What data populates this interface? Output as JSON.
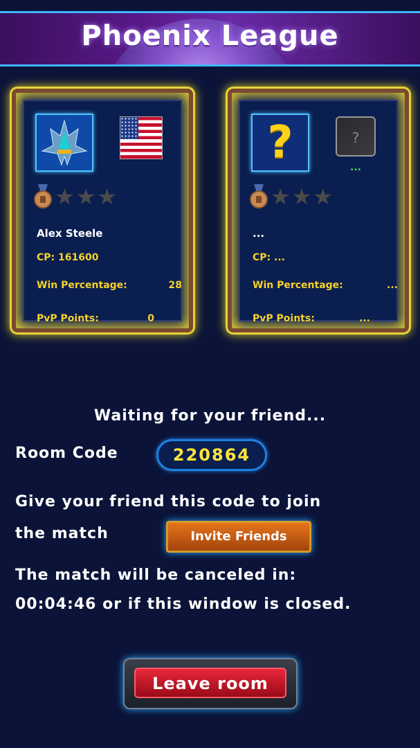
{
  "header": {
    "title": "Phoenix League"
  },
  "player1": {
    "name": "Alex Steele",
    "cp_label": "CP:",
    "cp_value": "161600",
    "win_label": "Win Percentage:",
    "win_value": "28",
    "pvp_label": "PvP Points:",
    "pvp_value": "0",
    "flag_icon": "usa-flag-icon",
    "stars_filled": 0,
    "stars_total": 3
  },
  "player2": {
    "name": "...",
    "cp_label": "CP:",
    "cp_value": "...",
    "win_label": "Win Percentage:",
    "win_value": "...",
    "pvp_label": "PvP Points:",
    "pvp_value": "...",
    "avatar_mark": "?",
    "flag_mark": "?",
    "flag_caption": "...",
    "stars_filled": 0,
    "stars_total": 3
  },
  "status": {
    "waiting": "Waiting for your friend...",
    "room_code_label": "Room Code",
    "room_code": "220864",
    "give_line1": "Give your friend this code to join",
    "give_line2": "the match",
    "invite_button": "Invite Friends",
    "cancel_line1": "The match will be canceled in:",
    "cancel_line2": "00:04:46 or if this window is closed."
  },
  "actions": {
    "leave_button": "Leave room"
  },
  "colors": {
    "background": "#0b1438",
    "accent_yellow": "#f5d22a",
    "code_yellow": "#ffe43a",
    "leave_red": "#e8283a",
    "invite_orange": "#e4741c"
  }
}
